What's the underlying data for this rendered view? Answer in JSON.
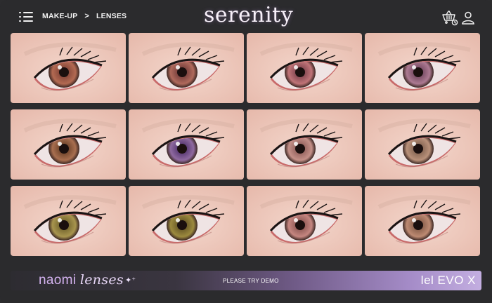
{
  "header": {
    "breadcrumbs": [
      "MAKE-UP",
      "LENSES"
    ],
    "separator": ">",
    "brand": "serenity",
    "menu_icon": "menu-icon",
    "cart_icon": "cart-icon",
    "user_icon": "user-icon"
  },
  "lenses": [
    {
      "iris": "#b36a52",
      "inner": "#8a4a3c"
    },
    {
      "iris": "#b06a5c",
      "inner": "#7d4440"
    },
    {
      "iris": "#c07478",
      "inner": "#8a4c55"
    },
    {
      "iris": "#ad7a92",
      "inner": "#7c5068"
    },
    {
      "iris": "#a96f50",
      "inner": "#76492f"
    },
    {
      "iris": "#8f6aa0",
      "inner": "#5e3e77"
    },
    {
      "iris": "#c49088",
      "inner": "#9a6863"
    },
    {
      "iris": "#b9917a",
      "inner": "#8c6b58"
    },
    {
      "iris": "#a8954e",
      "inner": "#7b6c33"
    },
    {
      "iris": "#9c8a3e",
      "inner": "#6f5f2a"
    },
    {
      "iris": "#c58680",
      "inner": "#97605c"
    },
    {
      "iris": "#bd8a72",
      "inner": "#8f6450"
    }
  ],
  "banner": {
    "brand_part1": "naomi",
    "brand_part2": "lenses",
    "sparkle": "✦⁺",
    "cta": "PLEASE TRY DEMO",
    "compat": "lel EVO X"
  }
}
